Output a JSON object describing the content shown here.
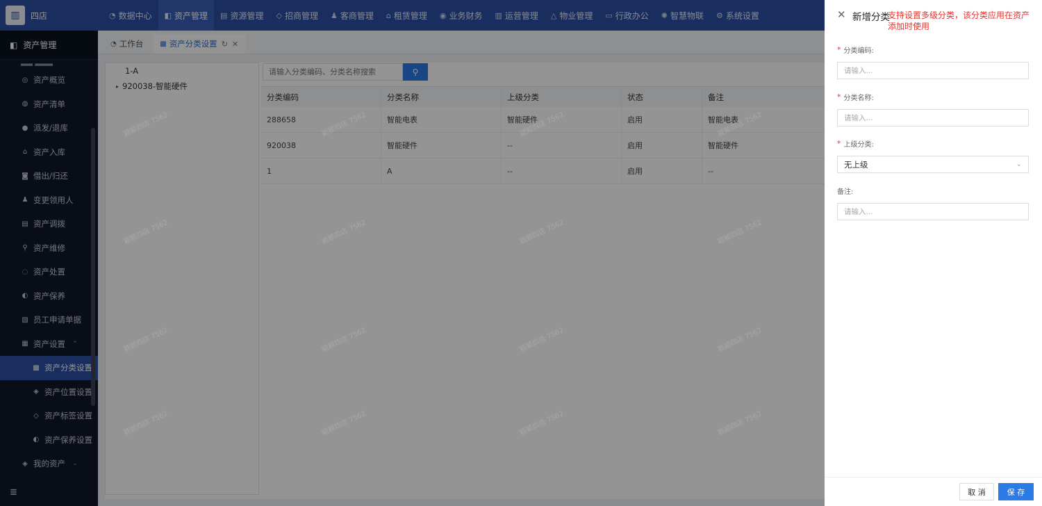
{
  "header": {
    "store_name": "四店",
    "nav": [
      {
        "label": "数据中心",
        "icon": "dashboard-icon",
        "glyph": "◔"
      },
      {
        "label": "资产管理",
        "icon": "cube-icon",
        "glyph": "◧",
        "active": true
      },
      {
        "label": "资源管理",
        "icon": "document-icon",
        "glyph": "▤"
      },
      {
        "label": "招商管理",
        "icon": "tag-icon",
        "glyph": "◇"
      },
      {
        "label": "客商管理",
        "icon": "people-icon",
        "glyph": "♟"
      },
      {
        "label": "租赁管理",
        "icon": "house-icon",
        "glyph": "⌂"
      },
      {
        "label": "业务财务",
        "icon": "coin-icon",
        "glyph": "◉"
      },
      {
        "label": "运营管理",
        "icon": "chart-icon",
        "glyph": "▥"
      },
      {
        "label": "物业管理",
        "icon": "building-icon",
        "glyph": "△"
      },
      {
        "label": "行政办公",
        "icon": "monitor-icon",
        "glyph": "▭"
      },
      {
        "label": "智慧物联",
        "icon": "iot-icon",
        "glyph": "✺"
      },
      {
        "label": "系统设置",
        "icon": "gear-icon",
        "glyph": "⚙"
      }
    ]
  },
  "sidebar": {
    "title": "资产管理",
    "items": [
      {
        "label": "资产概览",
        "icon": "overview-icon",
        "glyph": "◎"
      },
      {
        "label": "资产清单",
        "icon": "list-icon",
        "glyph": "◍"
      },
      {
        "label": "派发/退库",
        "icon": "dispatch-icon",
        "glyph": "●"
      },
      {
        "label": "资产入库",
        "icon": "inbound-icon",
        "glyph": "⌂"
      },
      {
        "label": "借出/归还",
        "icon": "lend-icon",
        "glyph": "◙"
      },
      {
        "label": "变更领用人",
        "icon": "user-icon",
        "glyph": "♟"
      },
      {
        "label": "资产调拨",
        "icon": "transfer-icon",
        "glyph": "▤"
      },
      {
        "label": "资产维修",
        "icon": "repair-icon",
        "glyph": "⚲"
      },
      {
        "label": "资产处置",
        "icon": "dispose-icon",
        "glyph": "◌"
      },
      {
        "label": "资产保养",
        "icon": "maintain-icon",
        "glyph": "◐"
      },
      {
        "label": "员工申请单据",
        "icon": "form-icon",
        "glyph": "▧"
      },
      {
        "label": "资产设置",
        "icon": "settings-icon",
        "glyph": "▦",
        "expand": "⌃"
      },
      {
        "label": "资产分类设置",
        "icon": "category-icon",
        "glyph": "▩",
        "sub": true,
        "active": true
      },
      {
        "label": "资产位置设置",
        "icon": "location-icon",
        "glyph": "◈",
        "sub": true
      },
      {
        "label": "资产标签设置",
        "icon": "label-icon",
        "glyph": "◇",
        "sub": true
      },
      {
        "label": "资产保养设置",
        "icon": "maintain-setting-icon",
        "glyph": "◐",
        "sub": true
      },
      {
        "label": "我的资产",
        "icon": "my-asset-icon",
        "glyph": "◈",
        "expand": "⌄"
      }
    ],
    "collapse_glyph": "≣"
  },
  "tabs": [
    {
      "label": "工作台",
      "icon": "workbench-icon",
      "glyph": "◔"
    },
    {
      "label": "资产分类设置",
      "icon": "category-icon",
      "glyph": "▩",
      "active": true
    }
  ],
  "tree": [
    {
      "label": "1-A",
      "level": 1
    },
    {
      "label": "920038-智能硬件",
      "level": 2,
      "arrow": "▸"
    }
  ],
  "search": {
    "placeholder": "请输入分类编码、分类名称搜索",
    "button_glyph": "⚲"
  },
  "table": {
    "columns": [
      "分类编码",
      "分类名称",
      "上级分类",
      "状态",
      "备注"
    ],
    "rows": [
      [
        "288658",
        "智能电表",
        "智能硬件",
        "启用",
        "智能电表"
      ],
      [
        "920038",
        "智能硬件",
        "--",
        "启用",
        "智能硬件"
      ],
      [
        "1",
        "A",
        "--",
        "启用",
        "--"
      ]
    ]
  },
  "watermark": "颖颖四店 7562",
  "drawer": {
    "title": "新增分类",
    "note": "支持设置多级分类，该分类应用在资产添加时使用",
    "fields": [
      {
        "label": "分类编码:",
        "required": true,
        "placeholder": "请输入..."
      },
      {
        "label": "分类名称:",
        "required": true,
        "placeholder": "请输入..."
      },
      {
        "label": "上级分类:",
        "required": true,
        "value": "无上级"
      },
      {
        "label": "备注:",
        "required": false,
        "placeholder": "请输入..."
      }
    ],
    "cancel_label": "取 消",
    "save_label": "保 存"
  },
  "colors": {
    "primary": "#2b4fa3",
    "accent": "#2b7ae6",
    "sidebar": "#101828",
    "danger": "#e8322e"
  }
}
